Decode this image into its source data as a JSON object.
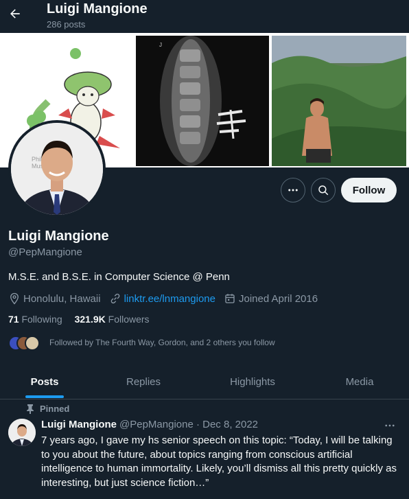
{
  "header": {
    "name": "Luigi Mangione",
    "post_count": "286 posts"
  },
  "profile": {
    "name": "Luigi Mangione",
    "handle": "@PepMangione",
    "bio": "M.S.E. and B.S.E. in Computer Science @ Penn",
    "location": "Honolulu, Hawaii",
    "link": "linktr.ee/lnmangione",
    "joined": "Joined April 2016",
    "following_count": "71",
    "following_label": "Following",
    "followers_count": "321.9K",
    "followers_label": "Followers",
    "followed_by": "Followed by The Fourth Way, Gordon, and 2 others you follow",
    "avatar_caption": "Philad Muse"
  },
  "actions": {
    "follow_label": "Follow",
    "more_icon": "more-icon",
    "search_icon": "search-icon"
  },
  "tabs": [
    {
      "label": "Posts",
      "active": true
    },
    {
      "label": "Replies",
      "active": false
    },
    {
      "label": "Highlights",
      "active": false
    },
    {
      "label": "Media",
      "active": false
    }
  ],
  "post": {
    "pinned_label": "Pinned",
    "author": "Luigi Mangione",
    "meta": "@PepMangione · Dec 8, 2022",
    "text": "7 years ago, I gave my hs senior speech on this topic: “Today, I will be talking to you about the future, about topics ranging from conscious artificial intelligence to human immortality. Likely, you’ll dismiss all this pretty quickly as interesting, but just science fiction…”"
  },
  "colors": {
    "background": "#15202b",
    "accent": "#1d9bf0",
    "secondary_text": "#8b98a5"
  }
}
